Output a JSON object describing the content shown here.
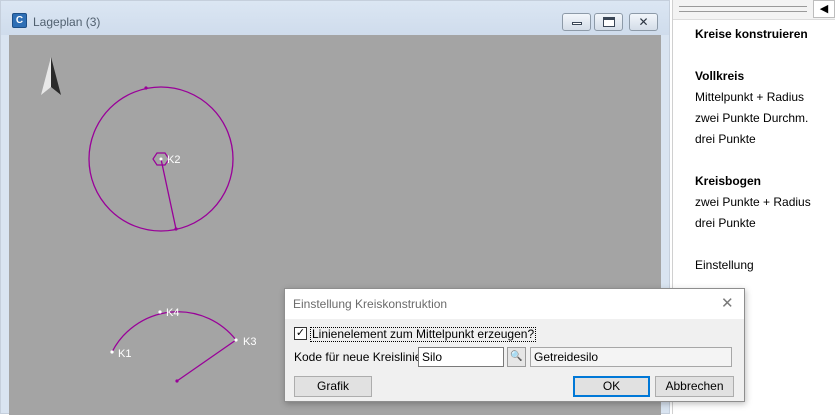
{
  "window": {
    "title": "Lageplan (3)",
    "icon": "app-icon",
    "controls": [
      "minimize-icon",
      "maximize-icon",
      "close-icon"
    ]
  },
  "drawing": {
    "line_color": "#990099",
    "label_color": "#ffffff",
    "points": [
      {
        "label": "K2"
      },
      {
        "label": "K4"
      },
      {
        "label": "K1"
      },
      {
        "label": "K3"
      }
    ],
    "north_arrow": "north-arrow-icon"
  },
  "panel": {
    "title": "Kreise konstruieren",
    "sections": [
      {
        "heading": "Vollkreis",
        "items": [
          "Mittelpunkt + Radius",
          "zwei Punkte Durchm.",
          "drei Punkte"
        ]
      },
      {
        "heading": "Kreisbogen",
        "items": [
          "zwei Punkte + Radius",
          "drei Punkte"
        ]
      }
    ],
    "settings_label": "Einstellung",
    "collapse_icon": "collapse-left-icon"
  },
  "dialog": {
    "title": "Einstellung Kreiskonstruktion",
    "checkbox_label": "Linienelement zum Mittelpunkt erzeugen?",
    "checkbox_checked": true,
    "code_label": "Kode für neue Kreislinien:",
    "code_value": "Silo",
    "description_value": "Getreidesilo",
    "buttons": {
      "grafik": "Grafik",
      "ok": "OK",
      "cancel": "Abbrechen"
    }
  }
}
